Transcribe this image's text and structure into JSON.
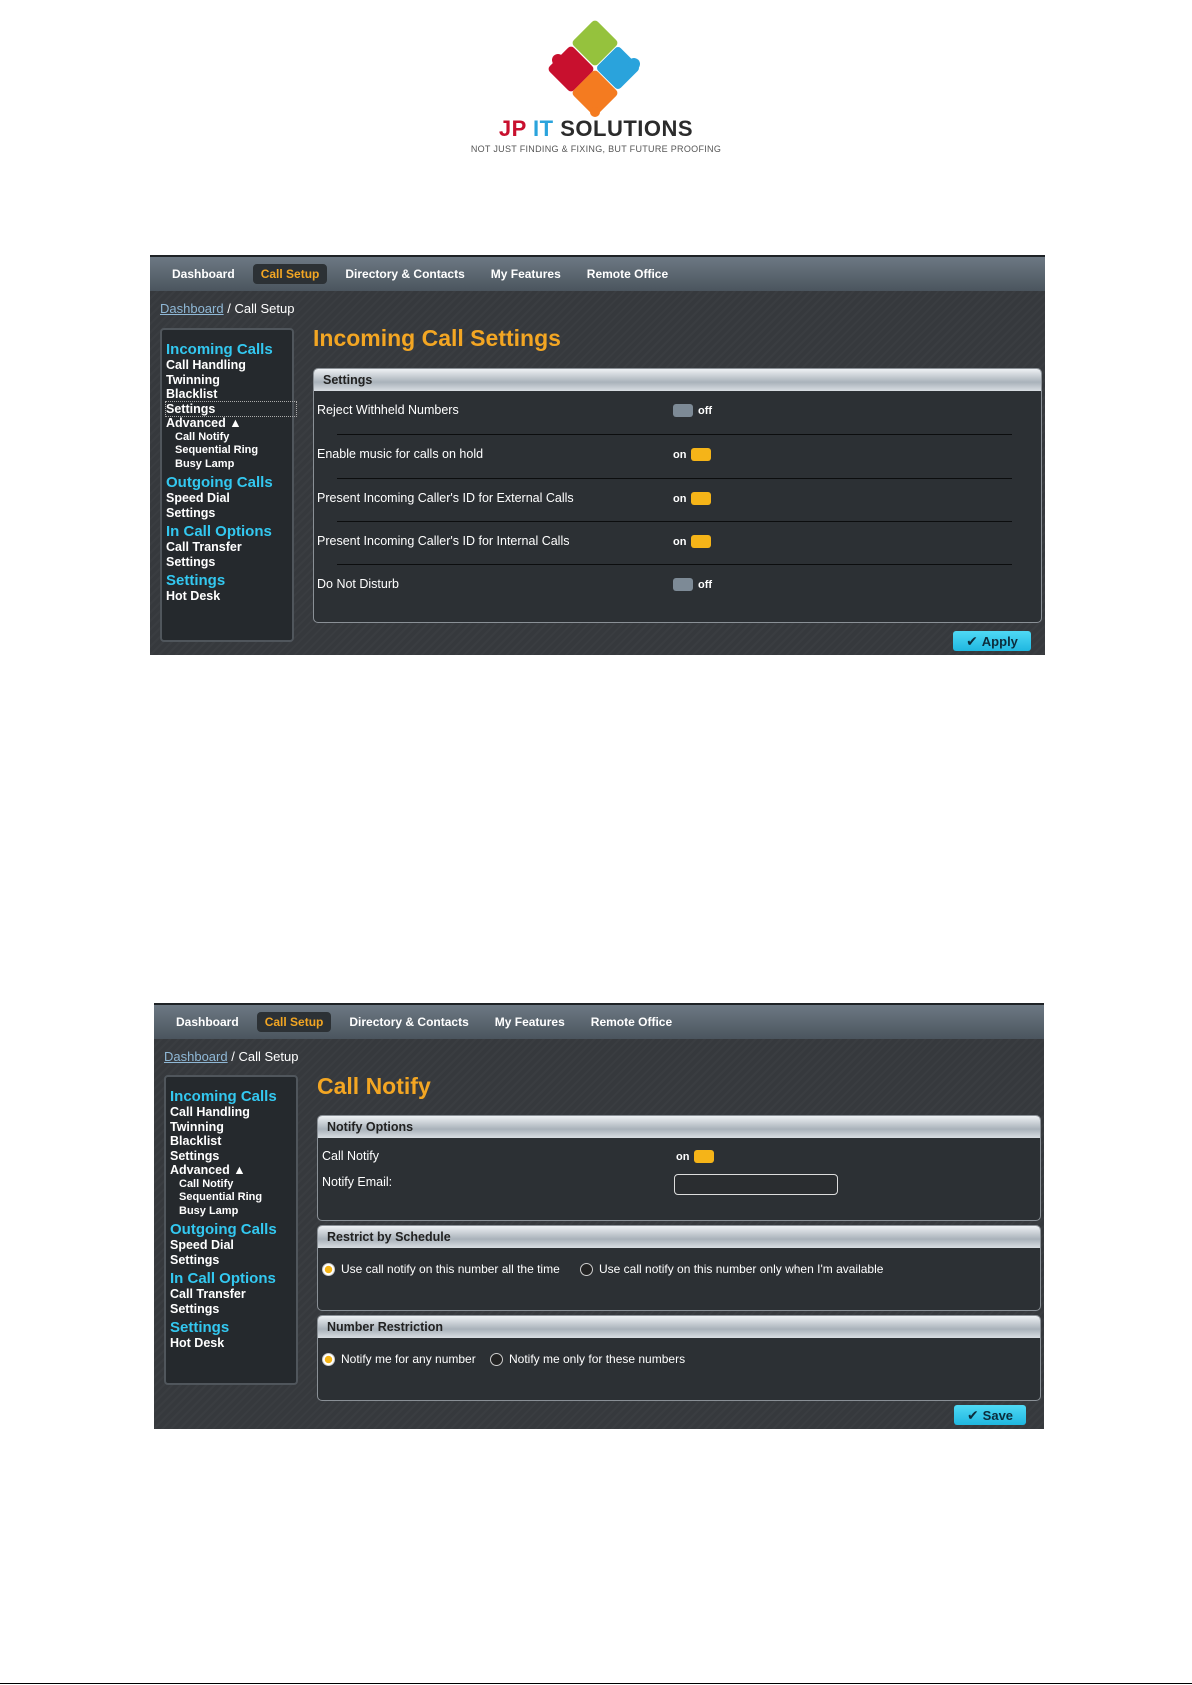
{
  "logo": {
    "word1": "JP",
    "word2": "IT",
    "word3": "SOLUTIONS",
    "tagline": "NOT JUST FINDING & FIXING, BUT FUTURE PROOFING"
  },
  "nav": {
    "tabs": [
      "Dashboard",
      "Call Setup",
      "Directory & Contacts",
      "My Features",
      "Remote Office"
    ],
    "active": "Call Setup"
  },
  "breadcrumb": {
    "link": "Dashboard",
    "rest": " / Call Setup"
  },
  "sidebar": {
    "incoming": "Incoming Calls",
    "call_handling": "Call Handling",
    "twinning": "Twinning",
    "blacklist": "Blacklist",
    "settings": "Settings",
    "advanced": "Advanced ▲",
    "call_notify": "Call Notify",
    "sequential_ring": "Sequential Ring",
    "busy_lamp": "Busy Lamp",
    "outgoing": "Outgoing Calls",
    "speed_dial": "Speed Dial",
    "out_settings": "Settings",
    "in_call": "In Call Options",
    "call_transfer": "Call Transfer",
    "in_call_settings": "Settings",
    "settings_group": "Settings",
    "hot_desk": "Hot Desk"
  },
  "screen1": {
    "title": "Incoming Call Settings",
    "panel_title": "Settings",
    "rows": [
      {
        "label": "Reject Withheld Numbers",
        "state": "off"
      },
      {
        "label": "Enable music for calls on hold",
        "state": "on"
      },
      {
        "label": "Present Incoming Caller's ID for External Calls",
        "state": "on"
      },
      {
        "label": "Present Incoming Caller's ID for Internal Calls",
        "state": "on"
      },
      {
        "label": "Do Not Disturb",
        "state": "off"
      }
    ],
    "apply": "Apply"
  },
  "screen2": {
    "title": "Call Notify",
    "notify_panel": "Notify Options",
    "call_notify_label": "Call Notify",
    "call_notify_state": "on",
    "notify_email_label": "Notify Email:",
    "notify_email_value": "",
    "schedule_panel": "Restrict by Schedule",
    "schedule_opt1": "Use call notify on this number all the time",
    "schedule_opt2": "Use call notify on this number only when I'm available",
    "schedule_selected": 1,
    "number_panel": "Number Restriction",
    "number_opt1": "Notify me for any number",
    "number_opt2": "Notify me only for these numbers",
    "number_selected": 1,
    "save": "Save"
  },
  "colors": {
    "accent_orange": "#f3a623",
    "accent_cyan": "#33c8f0",
    "toggle_on": "#f5b418",
    "toggle_off": "#7d8a96"
  }
}
